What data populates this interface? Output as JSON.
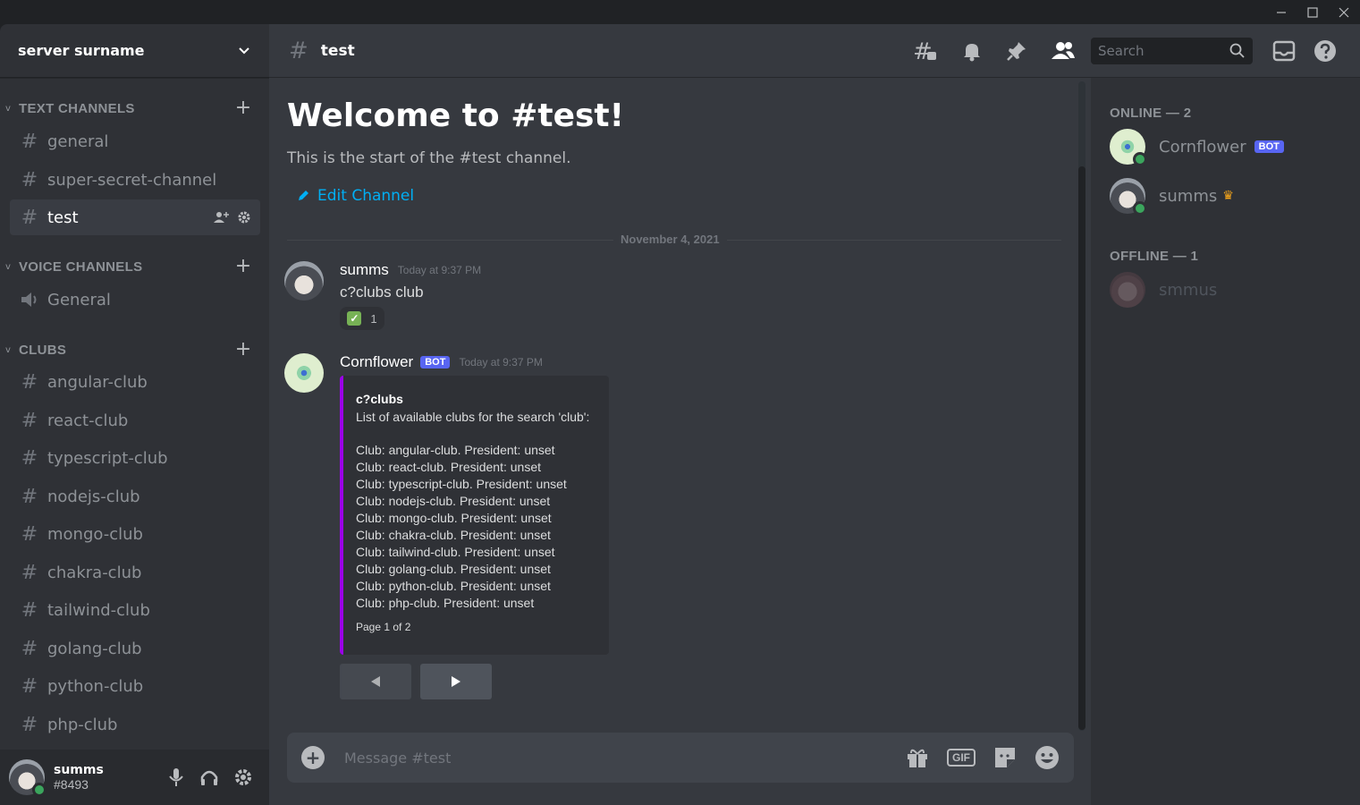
{
  "window": {
    "controls": [
      "minimize",
      "maximize",
      "close"
    ]
  },
  "server": {
    "name": "server surname"
  },
  "categories": {
    "text": {
      "label": "TEXT CHANNELS"
    },
    "voice": {
      "label": "VOICE CHANNELS"
    },
    "clubs": {
      "label": "CLUBS"
    }
  },
  "text_channels": [
    {
      "name": "general"
    },
    {
      "name": "super-secret-channel"
    },
    {
      "name": "test"
    }
  ],
  "voice_channels": [
    {
      "name": "General"
    }
  ],
  "club_channels": [
    {
      "name": "angular-club"
    },
    {
      "name": "react-club"
    },
    {
      "name": "typescript-club"
    },
    {
      "name": "nodejs-club"
    },
    {
      "name": "mongo-club"
    },
    {
      "name": "chakra-club"
    },
    {
      "name": "tailwind-club"
    },
    {
      "name": "golang-club"
    },
    {
      "name": "python-club"
    },
    {
      "name": "php-club"
    }
  ],
  "user": {
    "name": "summs",
    "tag": "#8493"
  },
  "header": {
    "channel": "test",
    "search_placeholder": "Search"
  },
  "welcome": {
    "title": "Welcome to #test!",
    "subtitle": "This is the start of the #test channel.",
    "edit_label": "Edit Channel"
  },
  "date_divider": "November 4, 2021",
  "messages": [
    {
      "author": "summs",
      "time": "Today at 9:37 PM",
      "text": "c?clubs club",
      "reaction_count": "1"
    },
    {
      "author": "Cornflower",
      "bot_tag": "BOT",
      "time": "Today at 9:37 PM",
      "embed": {
        "title": "c?clubs",
        "description": "List of available clubs for the search 'club':",
        "lines": [
          "Club: angular-club. President: unset",
          "Club: react-club. President: unset",
          "Club: typescript-club. President: unset",
          "Club: nodejs-club. President: unset",
          "Club: mongo-club. President: unset",
          "Club: chakra-club. President: unset",
          "Club: tailwind-club. President: unset",
          "Club: golang-club. President: unset",
          "Club: python-club. President: unset",
          "Club: php-club. President: unset"
        ],
        "footer": "Page 1 of 2",
        "accent": "#9b00e8"
      }
    }
  ],
  "composer": {
    "placeholder": "Message #test",
    "gif_label": "GIF"
  },
  "member_groups": {
    "online": "ONLINE — 2",
    "offline": "OFFLINE — 1"
  },
  "members": [
    {
      "name": "Cornflower",
      "bot_tag": "BOT",
      "status": "online"
    },
    {
      "name": "summs",
      "status": "online",
      "owner": true
    },
    {
      "name": "smmus",
      "status": "offline"
    }
  ],
  "colors": {
    "accent_link": "#00aff4",
    "bot_tag": "#5865f2",
    "online": "#3ba55d",
    "embed_accent": "#9b00e8"
  }
}
